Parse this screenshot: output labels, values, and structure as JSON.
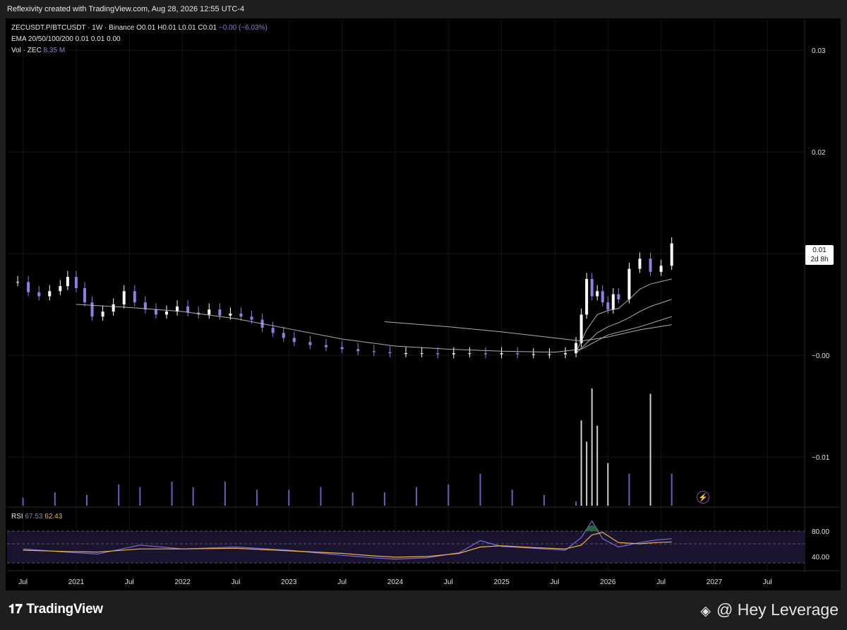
{
  "header": {
    "created_text": "Reflexivity created with TradingView.com, Aug 28, 2026 12:55 UTC-4"
  },
  "legend": {
    "symbol_line": "ZECUSDT.P/BTCUSDT · 1W · Binance",
    "ohlc_o": "O0.01",
    "ohlc_h": "H0.01",
    "ohlc_l": "L0.01",
    "ohlc_c": "C0.01",
    "change": "−0.00 (−6.03%)",
    "ema_line": "EMA 20/50/100/200  0.01  0.01  0.00",
    "vol_label": "Vol · ZEC",
    "vol_value": "8.35 M",
    "rsi_label": "RSI",
    "rsi_value": "67.53",
    "rsi_ma_value": "62.43"
  },
  "price_box": {
    "price": "0.01",
    "countdown": "2d 8h"
  },
  "footer": {
    "brand": "TradingView",
    "watermark": "@ Hey Leverage"
  },
  "colors": {
    "candle": "#8f7fe0",
    "candle_up": "#ffffff",
    "volume": "#6a5fbf",
    "rsi_line": "#7b6fd6",
    "rsi_ma": "#f0b24a",
    "ema": "#cccccc"
  },
  "chart_data": [
    {
      "type": "candlestick",
      "title": "ZECUSDT.P/BTCUSDT · 1W · Binance",
      "x_tick_labels": [
        "Jul",
        "2021",
        "Jul",
        "2022",
        "Jul",
        "2023",
        "Jul",
        "2024",
        "Jul",
        "2025",
        "Jul",
        "2026",
        "Jul",
        "2027",
        "Jul"
      ],
      "y_tick_labels": [
        "0.03",
        "0.02",
        "0.01",
        "−0.00",
        "−0.01"
      ],
      "ylim": [
        -0.015,
        0.033
      ],
      "series": [
        {
          "name": "ZECUSDT.P/BTCUSDT",
          "x": [
            2020.45,
            2020.55,
            2020.65,
            2020.75,
            2020.85,
            2020.92,
            2021.0,
            2021.08,
            2021.15,
            2021.25,
            2021.35,
            2021.45,
            2021.55,
            2021.65,
            2021.75,
            2021.85,
            2021.95,
            2022.05,
            2022.15,
            2022.25,
            2022.35,
            2022.45,
            2022.55,
            2022.65,
            2022.75,
            2022.85,
            2022.95,
            2023.05,
            2023.2,
            2023.35,
            2023.5,
            2023.65,
            2023.8,
            2023.95,
            2024.1,
            2024.25,
            2024.4,
            2024.55,
            2024.7,
            2024.85,
            2025.0,
            2025.15,
            2025.3,
            2025.45,
            2025.6,
            2025.7,
            2025.75,
            2025.8,
            2025.85,
            2025.9,
            2025.95,
            2026.0,
            2026.05,
            2026.1,
            2026.2,
            2026.3,
            2026.4,
            2026.5,
            2026.6
          ],
          "close": [
            0.0072,
            0.0062,
            0.0058,
            0.0063,
            0.0068,
            0.0077,
            0.0066,
            0.0052,
            0.0038,
            0.0043,
            0.005,
            0.0063,
            0.0052,
            0.0045,
            0.004,
            0.0043,
            0.0048,
            0.0042,
            0.004,
            0.0045,
            0.0039,
            0.0041,
            0.0038,
            0.0035,
            0.0027,
            0.0022,
            0.0017,
            0.0013,
            0.001,
            0.0008,
            0.0006,
            0.0004,
            0.0003,
            0.0002,
            0.0002,
            0.0002,
            0.0001,
            0.0002,
            0.0002,
            0.0001,
            0.0002,
            0.0001,
            0.0001,
            0.0001,
            0.0002,
            0.0012,
            0.004,
            0.0075,
            0.0058,
            0.0063,
            0.0052,
            0.0045,
            0.006,
            0.0055,
            0.0085,
            0.0095,
            0.0082,
            0.0088,
            0.011
          ]
        },
        {
          "name": "EMA 20",
          "x": [
            2025.7,
            2025.8,
            2025.9,
            2026.0,
            2026.1,
            2026.2,
            2026.3,
            2026.4,
            2026.6
          ],
          "y": [
            0.0003,
            0.0025,
            0.004,
            0.0044,
            0.0046,
            0.0055,
            0.0065,
            0.007,
            0.0075
          ]
        },
        {
          "name": "EMA 50",
          "x": [
            2025.7,
            2025.8,
            2025.9,
            2026.0,
            2026.1,
            2026.2,
            2026.3,
            2026.4,
            2026.6
          ],
          "y": [
            0.0002,
            0.0012,
            0.0022,
            0.0028,
            0.0032,
            0.0037,
            0.0043,
            0.0048,
            0.0055
          ]
        },
        {
          "name": "EMA 100",
          "x": [
            2021.0,
            2021.5,
            2022.0,
            2022.5,
            2023.0,
            2023.5,
            2024.0,
            2024.5,
            2025.0,
            2025.5,
            2025.75,
            2026.0,
            2026.3,
            2026.6
          ],
          "y": [
            0.005,
            0.0047,
            0.0043,
            0.0036,
            0.0026,
            0.0016,
            0.0009,
            0.0006,
            0.0004,
            0.0003,
            0.0006,
            0.002,
            0.0028,
            0.0038
          ]
        },
        {
          "name": "EMA 200",
          "x": [
            2023.9,
            2024.5,
            2025.0,
            2025.5,
            2025.75,
            2026.0,
            2026.3,
            2026.6
          ],
          "y": [
            0.0033,
            0.0028,
            0.0023,
            0.0017,
            0.0014,
            0.0018,
            0.0025,
            0.003
          ]
        }
      ]
    },
    {
      "type": "bar",
      "title": "Vol · ZEC",
      "x": [
        2020.5,
        2020.8,
        2021.1,
        2021.4,
        2021.6,
        2021.9,
        2022.1,
        2022.4,
        2022.7,
        2023.0,
        2023.3,
        2023.6,
        2023.9,
        2024.2,
        2024.5,
        2024.8,
        2025.1,
        2025.4,
        2025.7,
        2025.75,
        2025.8,
        2025.85,
        2025.9,
        2026.0,
        2026.2,
        2026.4,
        2026.6
      ],
      "values": [
        1.5,
        2.5,
        2.0,
        4.0,
        3.5,
        4.5,
        3.5,
        4.5,
        3.0,
        3.0,
        3.5,
        2.5,
        2.5,
        3.5,
        4.0,
        6.0,
        3.0,
        2.0,
        0.8,
        16.0,
        12.0,
        22.0,
        15.0,
        8.0,
        6.0,
        21.0,
        6.0
      ]
    },
    {
      "type": "line",
      "title": "RSI",
      "y_tick_labels": [
        "80.00",
        "40.00"
      ],
      "ylim": [
        20,
        100
      ],
      "series": [
        {
          "name": "RSI",
          "x": [
            2020.5,
            2020.9,
            2021.2,
            2021.6,
            2022.0,
            2022.5,
            2023.0,
            2023.5,
            2023.8,
            2024.0,
            2024.3,
            2024.6,
            2024.8,
            2025.0,
            2025.3,
            2025.6,
            2025.75,
            2025.85,
            2025.95,
            2026.1,
            2026.3,
            2026.45,
            2026.6
          ],
          "y": [
            52,
            47,
            44,
            58,
            52,
            55,
            50,
            42,
            38,
            36,
            38,
            46,
            65,
            56,
            53,
            50,
            70,
            96,
            68,
            55,
            62,
            66,
            68
          ]
        },
        {
          "name": "RSI MA",
          "x": [
            2020.5,
            2020.9,
            2021.2,
            2021.6,
            2022.0,
            2022.5,
            2023.0,
            2023.5,
            2023.8,
            2024.0,
            2024.3,
            2024.6,
            2024.8,
            2025.0,
            2025.3,
            2025.6,
            2025.75,
            2025.85,
            2025.95,
            2026.1,
            2026.3,
            2026.45,
            2026.6
          ],
          "y": [
            50,
            48,
            47,
            52,
            52,
            53,
            49,
            45,
            41,
            39,
            40,
            45,
            55,
            57,
            54,
            52,
            58,
            74,
            78,
            62,
            60,
            62,
            63
          ]
        }
      ]
    }
  ]
}
